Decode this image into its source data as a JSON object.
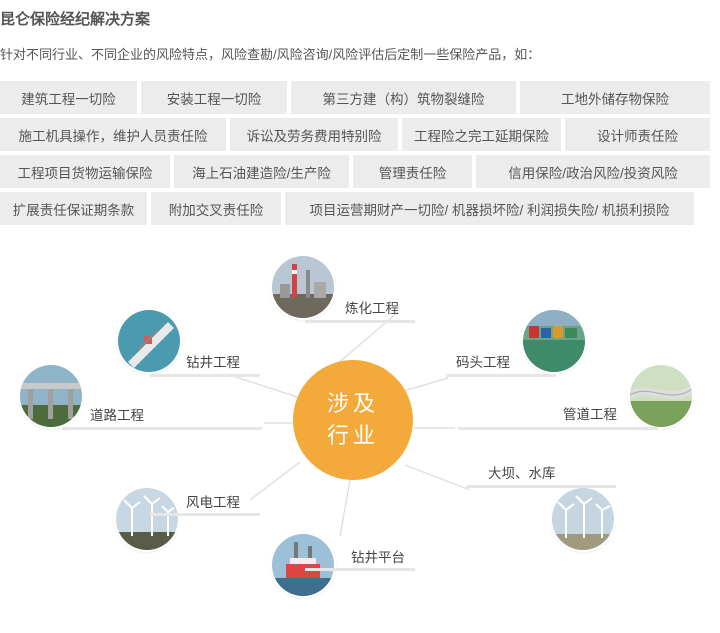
{
  "header": {
    "title": "昆仑保险经纪解决方案",
    "subtitle": "针对不同行业、不同企业的风险特点，风险查勘/风险咨询/风险评估后定制一些保险产品，如："
  },
  "products": {
    "row1": [
      "建筑工程一切险",
      "安装工程一切险",
      "第三方建（构）筑物裂缝险",
      "工地外储存物保险"
    ],
    "row2": [
      "施工机具操作，维护人员责任险",
      "诉讼及劳务费用特别险",
      "工程险之完工延期保险",
      "设计师责任险"
    ],
    "row3": [
      "工程项目货物运输保险",
      "海上石油建造险/生产险",
      "管理责任险",
      "信用保险/政治风险/投资风险"
    ],
    "row4": [
      "扩展责任保证期条款",
      "附加交叉责任险",
      "项目运营期财产一切险/ 机器损坏险/ 利润损失险/ 机损利损险"
    ]
  },
  "industries": {
    "center_line1": "涉及",
    "center_line2": "行业",
    "refinery": "炼化工程",
    "drilling": "钻井工程",
    "road": "道路工程",
    "wind": "风电工程",
    "platform": "钻井平台",
    "wharf": "码头工程",
    "pipeline": "管道工程",
    "dam": "大坝、水库"
  },
  "colors": {
    "hub": "#f4aa3a",
    "tag_bg": "#ececec",
    "bar": "#e6e6e6"
  },
  "icons": {
    "refinery": "refinery-photo-icon",
    "drilling": "drill-ship-photo-icon",
    "road": "bridge-photo-icon",
    "wind": "wind-turbine-photo-icon",
    "platform": "oil-platform-photo-icon",
    "wharf": "port-photo-icon",
    "pipeline": "pipeline-photo-icon",
    "dam": "wind-farm-photo-icon"
  }
}
